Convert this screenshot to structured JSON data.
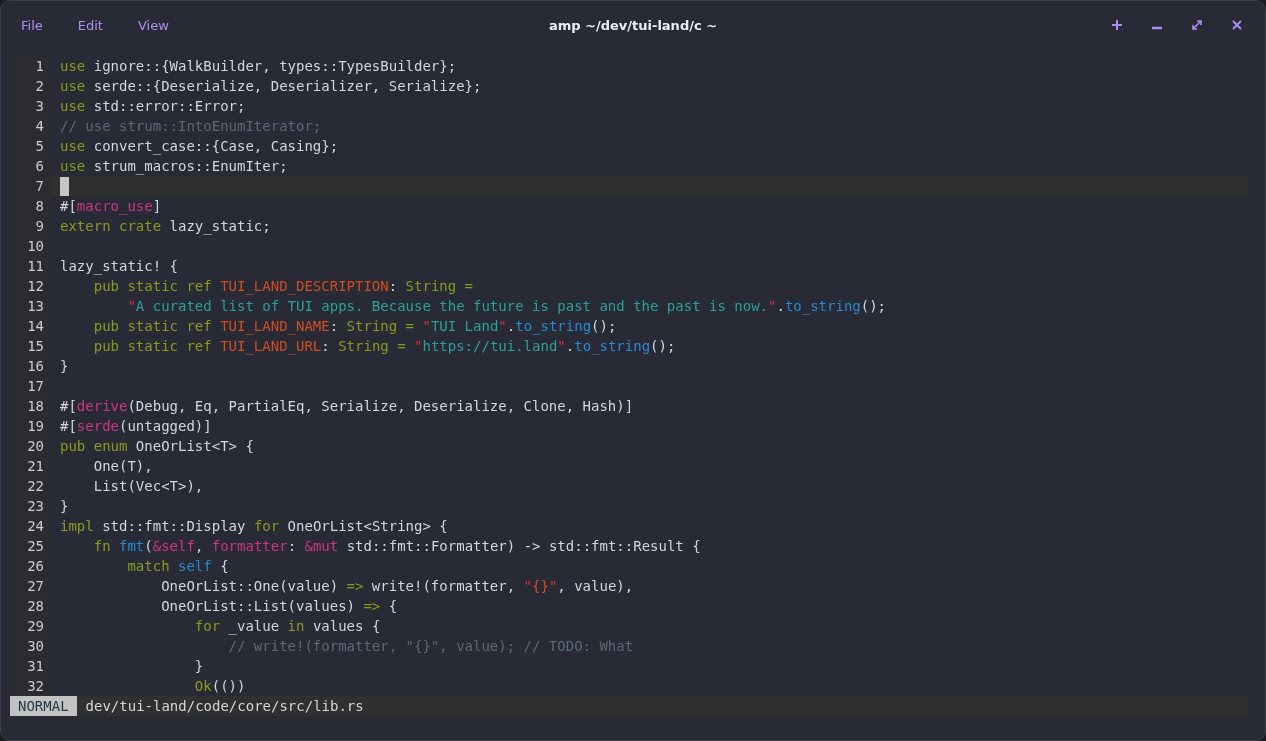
{
  "window": {
    "title": "amp ~/dev/tui-land/c ~"
  },
  "menu": [
    {
      "label": "File"
    },
    {
      "label": "Edit"
    },
    {
      "label": "View"
    }
  ],
  "lines": [
    {
      "number": "1",
      "current": false,
      "tokens": [
        {
          "kind": "kw",
          "text": "use"
        },
        {
          "kind": "plain",
          "text": " ignore::{WalkBuilder, types::TypesBuilder};"
        }
      ]
    },
    {
      "number": "2",
      "current": false,
      "tokens": [
        {
          "kind": "kw",
          "text": "use"
        },
        {
          "kind": "plain",
          "text": " serde::{Deserialize, Deserializer, Serialize};"
        }
      ]
    },
    {
      "number": "3",
      "current": false,
      "tokens": [
        {
          "kind": "kw",
          "text": "use"
        },
        {
          "kind": "plain",
          "text": " std::error::Error;"
        }
      ]
    },
    {
      "number": "4",
      "current": false,
      "tokens": [
        {
          "kind": "comment",
          "text": "// use strum::IntoEnumIterator;"
        }
      ]
    },
    {
      "number": "5",
      "current": false,
      "tokens": [
        {
          "kind": "kw",
          "text": "use"
        },
        {
          "kind": "plain",
          "text": " convert_case::{Case, Casing};"
        }
      ]
    },
    {
      "number": "6",
      "current": false,
      "tokens": [
        {
          "kind": "kw",
          "text": "use"
        },
        {
          "kind": "plain",
          "text": " strum_macros::EnumIter;"
        }
      ]
    },
    {
      "number": "7",
      "current": true
    },
    {
      "number": "8",
      "current": false,
      "tokens": [
        {
          "kind": "plain",
          "text": "#["
        },
        {
          "kind": "attr",
          "text": "macro_use"
        },
        {
          "kind": "plain",
          "text": "]"
        }
      ]
    },
    {
      "number": "9",
      "current": false,
      "tokens": [
        {
          "kind": "kw",
          "text": "extern crate"
        },
        {
          "kind": "plain",
          "text": " lazy_static;"
        }
      ]
    },
    {
      "number": "10",
      "current": false
    },
    {
      "number": "11",
      "current": false,
      "tokens": [
        {
          "kind": "plain",
          "text": "lazy_static! {"
        }
      ]
    },
    {
      "number": "12",
      "current": false,
      "tokens": [
        {
          "kind": "kw",
          "text": "    pub static ref "
        },
        {
          "kind": "const",
          "text": "TUI_LAND_DESCRIPTION"
        },
        {
          "kind": "plain",
          "text": ": "
        },
        {
          "kind": "kw",
          "text": "String ="
        }
      ]
    },
    {
      "number": "13",
      "current": false,
      "tokens": [
        {
          "kind": "quote",
          "text": "        \""
        },
        {
          "kind": "str",
          "text": "A curated list of TUI apps. Because the future is past and the past is now."
        },
        {
          "kind": "quote",
          "text": "\""
        },
        {
          "kind": "plain",
          "text": "."
        },
        {
          "kind": "fn",
          "text": "to_string"
        },
        {
          "kind": "plain",
          "text": "();"
        }
      ]
    },
    {
      "number": "14",
      "current": false,
      "tokens": [
        {
          "kind": "kw",
          "text": "    pub static ref "
        },
        {
          "kind": "const",
          "text": "TUI_LAND_NAME"
        },
        {
          "kind": "plain",
          "text": ": "
        },
        {
          "kind": "kw",
          "text": "String = "
        },
        {
          "kind": "quote",
          "text": "\""
        },
        {
          "kind": "str",
          "text": "TUI Land"
        },
        {
          "kind": "quote",
          "text": "\""
        },
        {
          "kind": "plain",
          "text": "."
        },
        {
          "kind": "fn",
          "text": "to_string"
        },
        {
          "kind": "plain",
          "text": "();"
        }
      ]
    },
    {
      "number": "15",
      "current": false,
      "tokens": [
        {
          "kind": "kw",
          "text": "    pub static ref "
        },
        {
          "kind": "const",
          "text": "TUI_LAND_URL"
        },
        {
          "kind": "plain",
          "text": ": "
        },
        {
          "kind": "kw",
          "text": "String = "
        },
        {
          "kind": "quote",
          "text": "\""
        },
        {
          "kind": "str",
          "text": "https://tui.land"
        },
        {
          "kind": "quote",
          "text": "\""
        },
        {
          "kind": "plain",
          "text": "."
        },
        {
          "kind": "fn",
          "text": "to_string"
        },
        {
          "kind": "plain",
          "text": "();"
        }
      ]
    },
    {
      "number": "16",
      "current": false,
      "tokens": [
        {
          "kind": "plain",
          "text": "}"
        }
      ]
    },
    {
      "number": "17",
      "current": false
    },
    {
      "number": "18",
      "current": false,
      "tokens": [
        {
          "kind": "plain",
          "text": "#["
        },
        {
          "kind": "attr",
          "text": "derive"
        },
        {
          "kind": "plain",
          "text": "(Debug, Eq, PartialEq, Serialize, Deserialize, Clone, Hash)]"
        }
      ]
    },
    {
      "number": "19",
      "current": false,
      "tokens": [
        {
          "kind": "plain",
          "text": "#["
        },
        {
          "kind": "attr",
          "text": "serde"
        },
        {
          "kind": "plain",
          "text": "(untagged)]"
        }
      ]
    },
    {
      "number": "20",
      "current": false,
      "tokens": [
        {
          "kind": "kw",
          "text": "pub enum"
        },
        {
          "kind": "plain",
          "text": " OneOrList<T> {"
        }
      ]
    },
    {
      "number": "21",
      "current": false,
      "tokens": [
        {
          "kind": "plain",
          "text": "    One(T),"
        }
      ]
    },
    {
      "number": "22",
      "current": false,
      "tokens": [
        {
          "kind": "plain",
          "text": "    List(Vec<T>),"
        }
      ]
    },
    {
      "number": "23",
      "current": false,
      "tokens": [
        {
          "kind": "plain",
          "text": "}"
        }
      ]
    },
    {
      "number": "24",
      "current": false,
      "tokens": [
        {
          "kind": "kw",
          "text": "impl"
        },
        {
          "kind": "plain",
          "text": " std::fmt::Display "
        },
        {
          "kind": "kw",
          "text": "for"
        },
        {
          "kind": "plain",
          "text": " OneOrList<String> {"
        }
      ]
    },
    {
      "number": "25",
      "current": false,
      "tokens": [
        {
          "kind": "kw",
          "text": "    fn "
        },
        {
          "kind": "fn",
          "text": "fmt"
        },
        {
          "kind": "plain",
          "text": "("
        },
        {
          "kind": "param",
          "text": "&self"
        },
        {
          "kind": "plain",
          "text": ", "
        },
        {
          "kind": "param",
          "text": "formatter"
        },
        {
          "kind": "plain",
          "text": ": "
        },
        {
          "kind": "param",
          "text": "&mut"
        },
        {
          "kind": "plain",
          "text": " std::fmt::Formatter) -> std::fmt::Result {"
        }
      ]
    },
    {
      "number": "26",
      "current": false,
      "tokens": [
        {
          "kind": "kw",
          "text": "        match "
        },
        {
          "kind": "fn",
          "text": "self"
        },
        {
          "kind": "plain",
          "text": " {"
        }
      ]
    },
    {
      "number": "27",
      "current": false,
      "tokens": [
        {
          "kind": "plain",
          "text": "            OneOrList::One(value) "
        },
        {
          "kind": "kw",
          "text": "=>"
        },
        {
          "kind": "plain",
          "text": " write!(formatter, "
        },
        {
          "kind": "quote",
          "text": "\""
        },
        {
          "kind": "const",
          "text": "{}"
        },
        {
          "kind": "quote",
          "text": "\""
        },
        {
          "kind": "plain",
          "text": ", value),"
        }
      ]
    },
    {
      "number": "28",
      "current": false,
      "tokens": [
        {
          "kind": "plain",
          "text": "            OneOrList::List(values) "
        },
        {
          "kind": "kw",
          "text": "=>"
        },
        {
          "kind": "plain",
          "text": " {"
        }
      ]
    },
    {
      "number": "29",
      "current": false,
      "tokens": [
        {
          "kind": "kw",
          "text": "                for"
        },
        {
          "kind": "plain",
          "text": " _value "
        },
        {
          "kind": "kw",
          "text": "in"
        },
        {
          "kind": "plain",
          "text": " values {"
        }
      ]
    },
    {
      "number": "30",
      "current": false,
      "tokens": [
        {
          "kind": "comment",
          "text": "                    // write!(formatter, \"{}\", value); // TODO: What"
        }
      ]
    },
    {
      "number": "31",
      "current": false,
      "tokens": [
        {
          "kind": "plain",
          "text": "                }"
        }
      ]
    },
    {
      "number": "32",
      "current": false,
      "tokens": [
        {
          "kind": "kw",
          "text": "                Ok"
        },
        {
          "kind": "plain",
          "text": "(())"
        }
      ]
    }
  ],
  "status_bar": {
    "mode": "NORMAL",
    "path": "dev/tui-land/code/core/src/lib.rs"
  }
}
